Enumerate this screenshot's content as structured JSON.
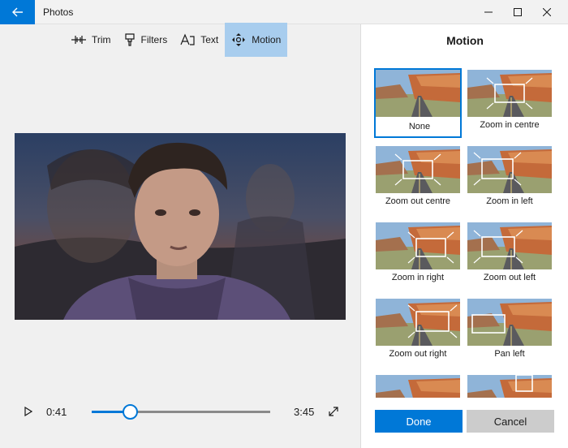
{
  "titlebar": {
    "app_title": "Photos"
  },
  "toolbar": [
    {
      "label": "Trim",
      "icon": "trim-icon"
    },
    {
      "label": "Filters",
      "icon": "filters-icon"
    },
    {
      "label": "Text",
      "icon": "text-icon"
    },
    {
      "label": "Motion",
      "icon": "motion-icon",
      "active": true
    }
  ],
  "player": {
    "current_time": "0:41",
    "total_time": "3:45",
    "progress": 0.214
  },
  "panel": {
    "title": "Motion",
    "options": [
      {
        "label": "None",
        "selected": true
      },
      {
        "label": "Zoom in centre"
      },
      {
        "label": "Zoom out centre"
      },
      {
        "label": "Zoom in left"
      },
      {
        "label": "Zoom in right"
      },
      {
        "label": "Zoom out left"
      },
      {
        "label": "Zoom out right"
      },
      {
        "label": "Pan left"
      },
      {
        "label": ""
      },
      {
        "label": ""
      }
    ],
    "done_label": "Done",
    "cancel_label": "Cancel"
  },
  "colors": {
    "accent": "#0078d7",
    "active_tool": "#a8cdee",
    "cancel": "#cccccc"
  }
}
